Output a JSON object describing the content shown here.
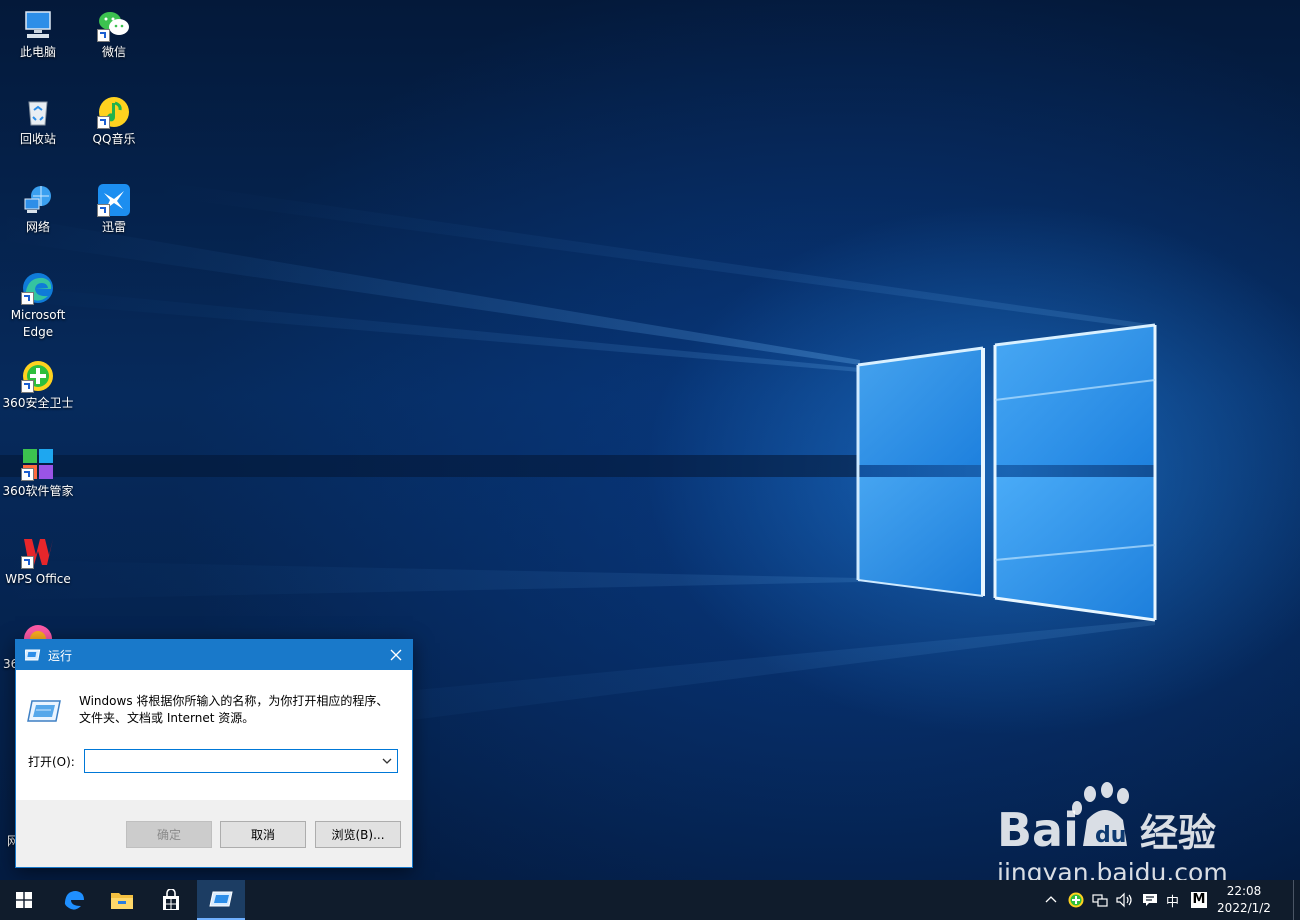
{
  "desktop": {
    "icons": [
      {
        "label": "此电脑"
      },
      {
        "label": "微信"
      },
      {
        "label": "回收站"
      },
      {
        "label": "QQ音乐"
      },
      {
        "label": "网络"
      },
      {
        "label": "迅雷"
      },
      {
        "label": "Microsoft Edge"
      },
      {
        "label": "360安全卫士"
      },
      {
        "label": "360软件管家"
      },
      {
        "label": "WPS Office"
      },
      {
        "label": "36"
      },
      {
        "label": "网"
      }
    ]
  },
  "run_dialog": {
    "title": "运行",
    "description": "Windows 将根据你所输入的名称，为你打开相应的程序、文件夹、文档或 Internet 资源。",
    "open_label": "打开(O):",
    "open_value": "",
    "ok_label": "确定",
    "cancel_label": "取消",
    "browse_label": "浏览(B)..."
  },
  "taskbar": {
    "apps": [
      "start-icon",
      "edge-icon",
      "file-explorer-icon",
      "store-icon",
      "run-icon"
    ],
    "tray": {
      "ime": "中",
      "ime_mode": "M"
    },
    "clock": {
      "time": "22:08",
      "date": "2022/1/2"
    }
  },
  "watermark": {
    "brand": "Bai",
    "brand_cn": "经验",
    "url": "jingyan.baidu.com"
  },
  "colors": {
    "titlebar": "#1979ca",
    "taskbar": "#101c2c",
    "focus": "#0078d7"
  }
}
